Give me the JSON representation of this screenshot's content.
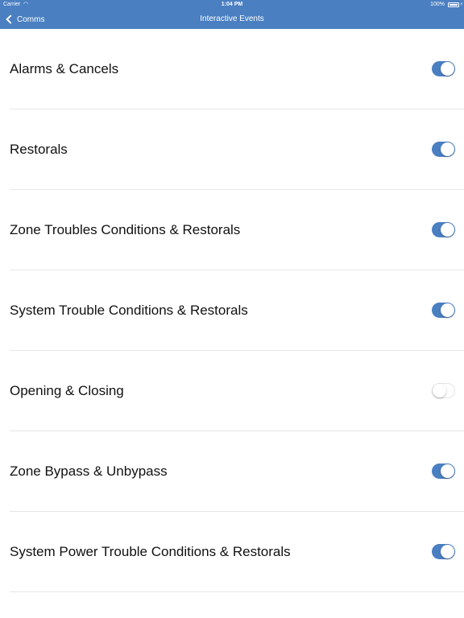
{
  "status_bar": {
    "carrier": "Carrier",
    "time": "1:04 PM",
    "battery": "100%",
    "wifi_icon": "wifi-icon",
    "battery_icon": "battery-icon"
  },
  "nav": {
    "back_label": "Comms",
    "title": "Interactive Events",
    "bar_color": "#4a7fc1"
  },
  "settings": [
    {
      "label": "Alarms & Cancels",
      "enabled": true
    },
    {
      "label": "Restorals",
      "enabled": true
    },
    {
      "label": "Zone Troubles Conditions & Restorals",
      "enabled": true
    },
    {
      "label": "System Trouble Conditions & Restorals",
      "enabled": true
    },
    {
      "label": "Opening & Closing",
      "enabled": false
    },
    {
      "label": "Zone Bypass & Unbypass",
      "enabled": true
    },
    {
      "label": "System Power Trouble Conditions & Restorals",
      "enabled": true
    }
  ],
  "colors": {
    "accent": "#4a7fc1",
    "separator": "#e6e6e6"
  }
}
